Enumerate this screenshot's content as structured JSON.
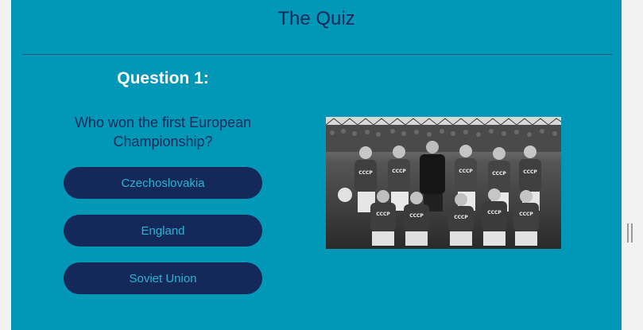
{
  "quiz": {
    "title": "The Quiz",
    "question_number": "Question 1:",
    "question_text": "Who won the first European Championship?",
    "answers": [
      {
        "label": "Czechoslovakia"
      },
      {
        "label": "England"
      },
      {
        "label": "Soviet Union"
      }
    ]
  },
  "image": {
    "subject": "black-and-white football team photo",
    "shirt_lettering": "CCCP"
  },
  "colors": {
    "page_background": "#f2f2f2",
    "panel_background": "#0198b8",
    "title_text": "#16295a",
    "question_number_text": "#ffffff",
    "answer_button_background": "#14285a",
    "answer_button_text": "#23b6d3"
  }
}
